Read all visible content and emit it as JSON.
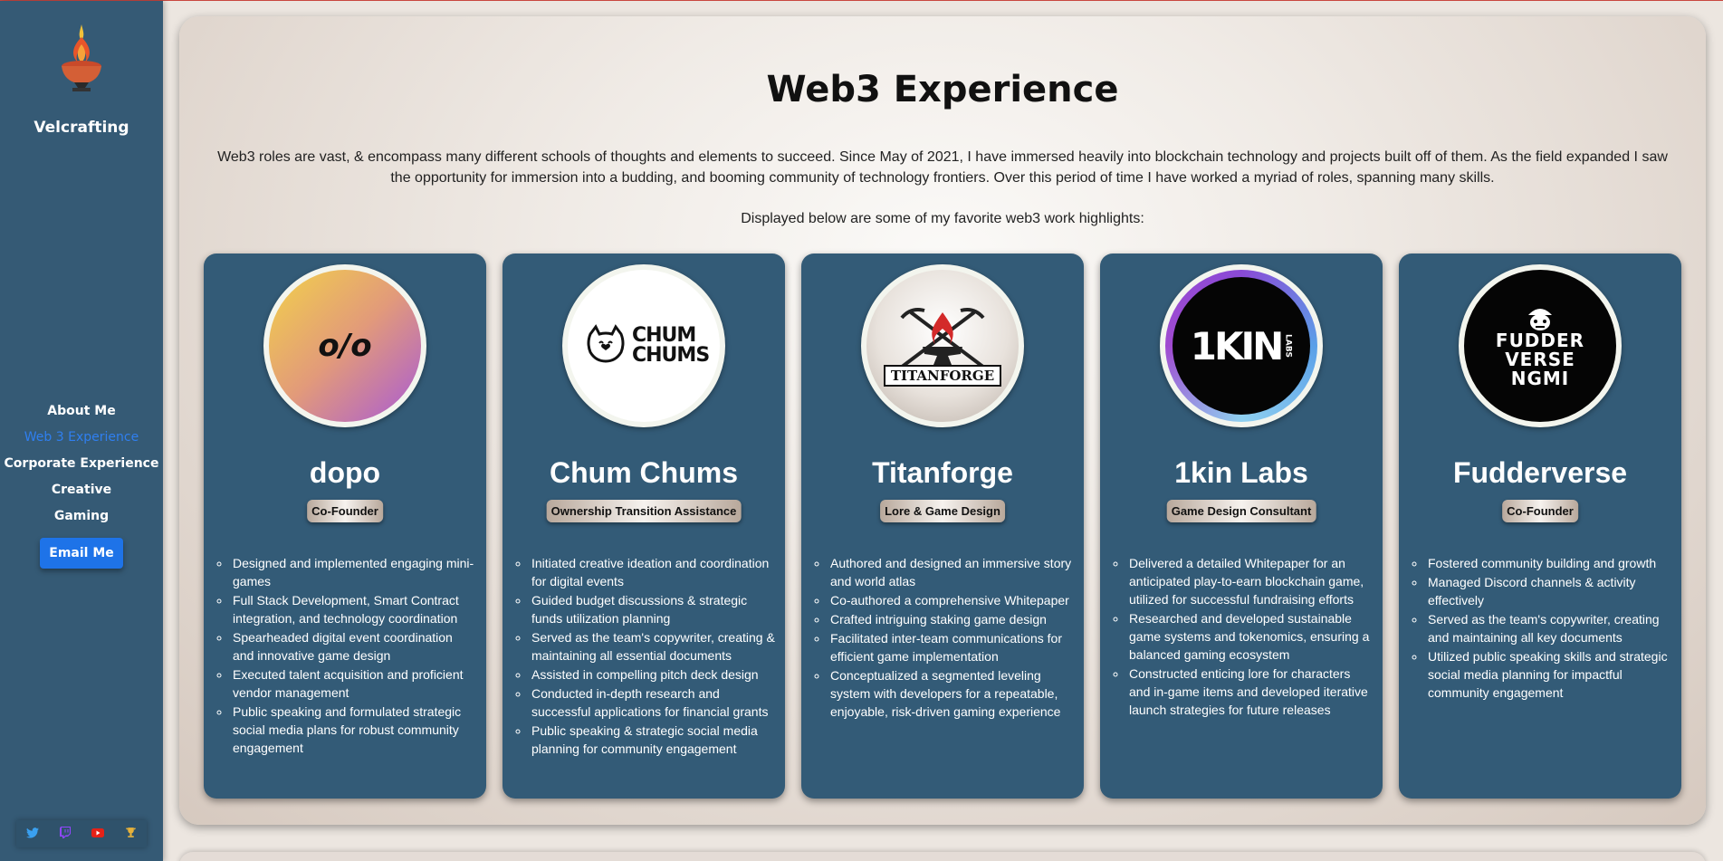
{
  "sidebar": {
    "brand": "Velcrafting",
    "nav": [
      {
        "label": "About Me",
        "active": false
      },
      {
        "label": "Web 3 Experience",
        "active": true
      },
      {
        "label": "Corporate Experience",
        "active": false
      },
      {
        "label": "Creative",
        "active": false
      },
      {
        "label": "Gaming",
        "active": false
      }
    ],
    "email_button": "Email Me",
    "socials": [
      "twitter-icon",
      "twitch-icon",
      "youtube-icon",
      "trophy-icon"
    ]
  },
  "main": {
    "title": "Web3 Experience",
    "intro": "Web3 roles are vast, & encompass many different schools of thoughts and elements to succeed. Since May of 2021, I have immersed heavily into blockchain technology and projects built off of them. As the field expanded I saw the opportunity for immersion into a budding, and booming community of technology frontiers. Over this period of time I have worked a myriad of roles, spanning many skills.",
    "intro2": "Displayed below are some of my favorite web3 work highlights:",
    "cards": [
      {
        "name": "dopo",
        "logo_text": "o/o",
        "role": "Co-Founder",
        "bullets": [
          "Designed and implemented engaging mini-games",
          "Full Stack Development, Smart Contract integration, and technology coordination",
          "Spearheaded digital event coordination and innovative game design",
          "Executed talent acquisition and proficient vendor management",
          "Public speaking and formulated strategic social media plans for robust community engagement"
        ]
      },
      {
        "name": "Chum Chums",
        "logo_text": "CHUM CHUMS",
        "role": "Ownership Transition Assistance",
        "bullets": [
          "Initiated creative ideation and coordination for digital events",
          "Guided budget discussions & strategic funds utilization planning",
          "Served as the team's copywriter, creating & maintaining all essential documents",
          "Assisted in compelling pitch deck design",
          "Conducted in-depth research and successful applications for financial grants",
          "Public speaking & strategic social media planning for community engagement"
        ]
      },
      {
        "name": "Titanforge",
        "logo_text": "TITANFORGE",
        "role": "Lore & Game Design",
        "bullets": [
          "Authored and designed an immersive story and world atlas",
          "Co-authored a comprehensive Whitepaper",
          "Crafted intriguing staking game design",
          "Facilitated inter-team communications for efficient game implementation",
          "Conceptualized a segmented leveling system with developers for a repeatable, enjoyable, risk-driven gaming experience"
        ]
      },
      {
        "name": "1kin Labs",
        "logo_text": "1KIN",
        "logo_sub": "LABS",
        "role": "Game Design Consultant",
        "bullets": [
          "Delivered a detailed Whitepaper for an anticipated play-to-earn blockchain game, utilized for successful fundraising efforts",
          "Researched and developed sustainable game systems and tokenomics, ensuring a balanced gaming ecosystem",
          "Constructed enticing lore for characters and in-game items and developed iterative launch strategies for future releases"
        ]
      },
      {
        "name": "Fudderverse",
        "logo_text": "FUDDER VERSE NGMI",
        "role": "Co-Founder",
        "bullets": [
          "Fostered community building and growth",
          "Managed Discord channels & activity effectively",
          "Served as the team's copywriter, creating and maintaining all key documents",
          "Utilized public speaking skills and strategic social media planning for impactful community engagement"
        ]
      }
    ]
  },
  "colors": {
    "sidebar": "#355a75",
    "card": "#335b77",
    "accent": "#1e73e8",
    "active_link": "#2f7ff0"
  }
}
